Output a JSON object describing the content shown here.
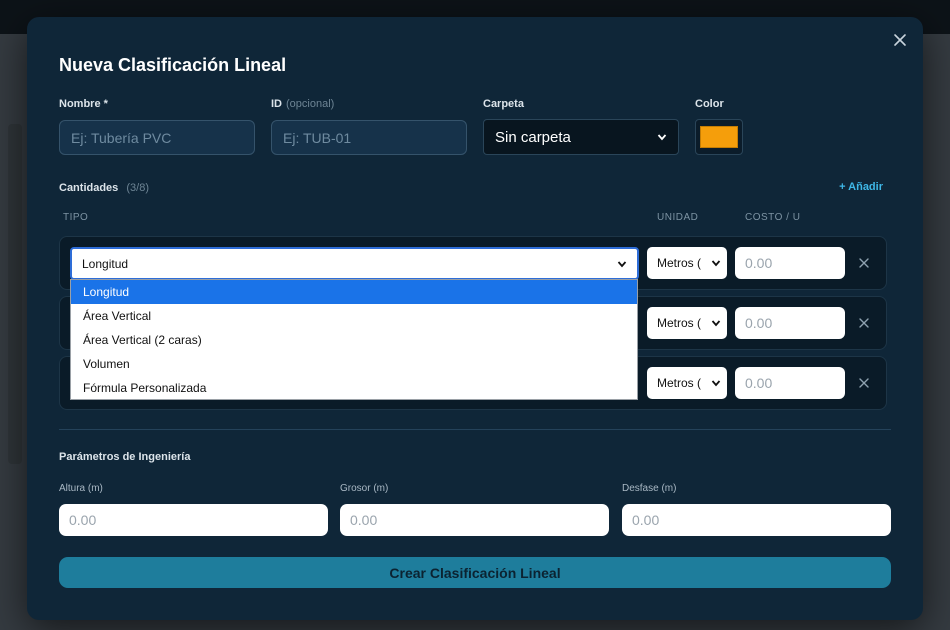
{
  "modal": {
    "title": "Nueva Clasificación Lineal",
    "close_icon": "close-icon"
  },
  "form": {
    "nombre_label": "Nombre *",
    "nombre_placeholder": "Ej: Tubería PVC",
    "id_label": "ID",
    "id_optional": "(opcional)",
    "id_placeholder": "Ej: TUB-01",
    "carpeta_label": "Carpeta",
    "carpeta_value": "Sin carpeta",
    "color_label": "Color",
    "color_value": "#f59e0b"
  },
  "quantities": {
    "label": "Cantidades",
    "count": "(3/8)",
    "add_label": "+ Añadir",
    "header_tipo": "TIPO",
    "header_unidad": "UNIDAD",
    "header_costo": "COSTO / U",
    "rows": [
      {
        "tipo": "Longitud",
        "unidad": "Metros (",
        "costo_placeholder": "0.00"
      },
      {
        "tipo": "",
        "unidad": "Metros (",
        "costo_placeholder": "0.00"
      },
      {
        "tipo": "",
        "unidad": "Metros (",
        "costo_placeholder": "0.00"
      }
    ],
    "dropdown_options": [
      "Longitud",
      "Área Vertical",
      "Área Vertical (2 caras)",
      "Volumen",
      "Fórmula Personalizada"
    ],
    "dropdown_selected": "Longitud"
  },
  "engineering": {
    "title": "Parámetros de Ingeniería",
    "altura_label": "Altura (m)",
    "altura_placeholder": "0.00",
    "grosor_label": "Grosor (m)",
    "grosor_placeholder": "0.00",
    "desfase_label": "Desfase (m)",
    "desfase_placeholder": "0.00"
  },
  "submit_label": "Crear Clasificación Lineal",
  "colors": {
    "modal_bg": "#0f2638",
    "accent": "#3fb8e8",
    "submit_bg": "#1e7d9c",
    "selection": "#1a73e8"
  }
}
